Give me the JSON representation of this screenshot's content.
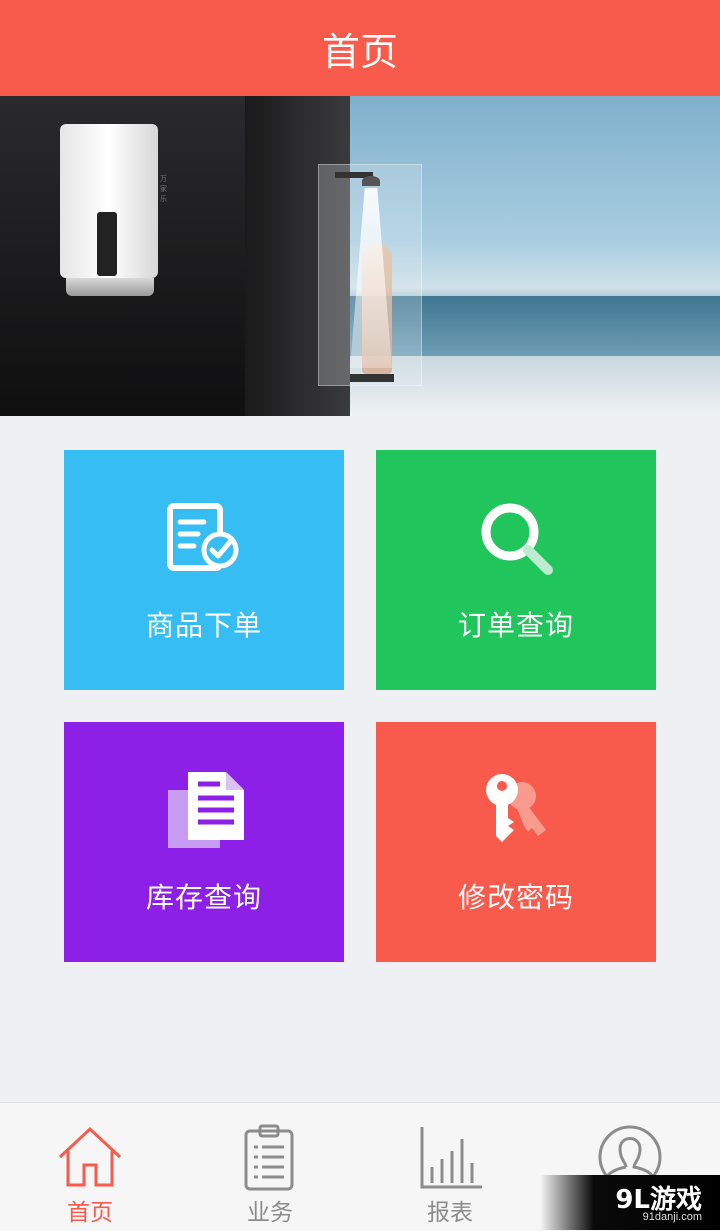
{
  "header": {
    "title": "首页"
  },
  "banner": {
    "heater_brand": "万家乐"
  },
  "tiles": [
    {
      "label": "商品下单",
      "icon": "checklist-icon",
      "color": "#35bdf4"
    },
    {
      "label": "订单查询",
      "icon": "search-icon",
      "color": "#20c55b"
    },
    {
      "label": "库存查询",
      "icon": "document-icon",
      "color": "#8d20e6"
    },
    {
      "label": "修改密码",
      "icon": "key-icon",
      "color": "#f85a4b"
    }
  ],
  "tabbar": {
    "active_color": "#f85a4b",
    "items": [
      {
        "label": "首页",
        "icon": "home-icon",
        "active": true
      },
      {
        "label": "业务",
        "icon": "clipboard-icon",
        "active": false
      },
      {
        "label": "报表",
        "icon": "bar-chart-icon",
        "active": false
      },
      {
        "label": "",
        "icon": "profile-icon",
        "active": false
      }
    ]
  },
  "watermark": {
    "main": "9L游戏",
    "sub": "91danji.com"
  }
}
